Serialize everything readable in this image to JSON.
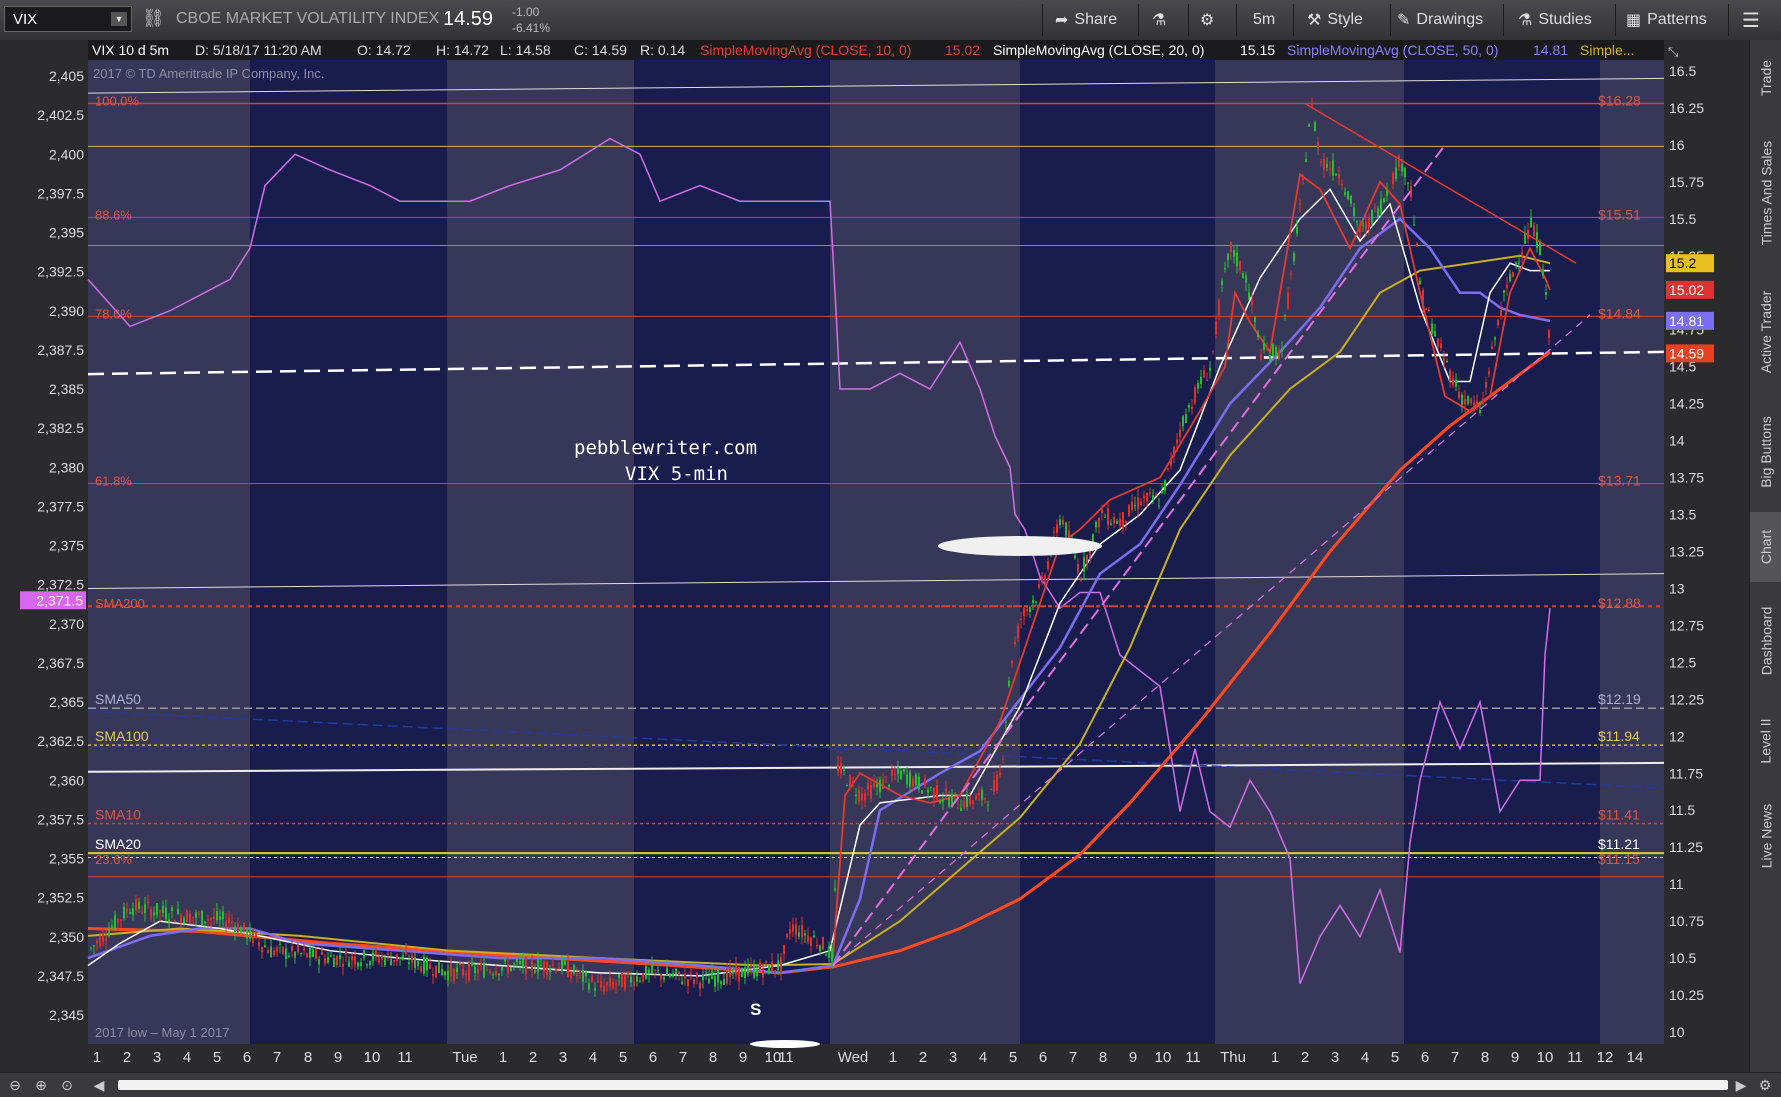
{
  "header": {
    "symbol": "VIX",
    "description": "CBOE MARKET VOLATILITY INDEX",
    "last": "14.59",
    "change": "-1.00",
    "change_pct": "-6.41%",
    "buttons": {
      "share": "Share",
      "period": "5m",
      "style": "Style",
      "drawings": "Drawings",
      "studies": "Studies",
      "patterns": "Patterns"
    }
  },
  "sidebar_tabs": [
    "Trade",
    "Times And Sales",
    "Active Trader",
    "Big Buttons",
    "Chart",
    "Dashboard",
    "Level II",
    "Live News"
  ],
  "chart": {
    "info": {
      "title": "VIX 10 d 5m",
      "date": "D: 5/18/17 11:20 AM",
      "open": "O: 14.72",
      "high": "H: 14.72",
      "low": "L: 14.58",
      "close": "C: 14.59",
      "range": "R: 0.14",
      "sma10": "SimpleMovingAvg (CLOSE, 10, 0)",
      "sma10_val": "15.02",
      "sma20": "SimpleMovingAvg (CLOSE, 20, 0)",
      "sma20_val": "15.15",
      "sma50": "SimpleMovingAvg (CLOSE, 50, 0)",
      "sma50_val": "14.81",
      "more": "Simple..."
    },
    "copyright": "2017 © TD Ameritrade IP Company, Inc.",
    "watermark_line1": "pebblewriter.com",
    "watermark_line2": "VIX 5-min",
    "bottom_note": "2017 low – May 1 2017",
    "s_label": "S",
    "left_axis": [
      "2,405",
      "2,402.5",
      "2,400",
      "2,397.5",
      "2,395",
      "2,392.5",
      "2,390",
      "2,387.5",
      "2,385",
      "2,382.5",
      "2,380",
      "2,377.5",
      "2,375",
      "2,372.5",
      "2,370",
      "2,367.5",
      "2,365",
      "2,362.5",
      "2,360",
      "2,357.5",
      "2,355",
      "2,352.5",
      "2,350",
      "2,347.5",
      "2,345"
    ],
    "right_axis": [
      "16.5",
      "16.25",
      "16",
      "15.75",
      "15.5",
      "15.25",
      "15",
      "14.75",
      "14.5",
      "14.25",
      "14",
      "13.75",
      "13.5",
      "13.25",
      "13",
      "12.75",
      "12.5",
      "12.25",
      "12",
      "11.75",
      "11.5",
      "11.25",
      "11",
      "10.75",
      "10.5",
      "10.25",
      "10"
    ],
    "left_price_tag": "2,371.5",
    "right_tags": {
      "sma20": "15.2",
      "sma10": "15.02",
      "sma50": "14.81",
      "last": "14.59"
    },
    "x_labels": [
      "1",
      "2",
      "3",
      "4",
      "5",
      "6",
      "7",
      "8",
      "9",
      "10",
      "11",
      "Tue",
      "1",
      "2",
      "3",
      "4",
      "5",
      "6",
      "7",
      "8",
      "9",
      "10",
      "11",
      "Wed",
      "1",
      "2",
      "3",
      "4",
      "5",
      "6",
      "7",
      "8",
      "9",
      "10",
      "11",
      "Thu",
      "1",
      "2",
      "3",
      "4",
      "5",
      "6",
      "7",
      "8",
      "9",
      "10",
      "11",
      "12",
      "14"
    ],
    "fib_levels": [
      {
        "label": "100.0%",
        "price": "$16.28"
      },
      {
        "label": "88.6%",
        "price": "$15.51"
      },
      {
        "label": "78.6%",
        "price": "$14.84"
      },
      {
        "label": "61.8%",
        "price": "$13.71"
      },
      {
        "label": "SMA200",
        "price": "$12.88"
      },
      {
        "label": "23.6%",
        "price": "$11.15"
      }
    ],
    "sma_levels": [
      {
        "label": "SMA50",
        "price": "$12.19"
      },
      {
        "label": "SMA100",
        "price": "$11.94"
      },
      {
        "label": "SMA10",
        "price": "$11.41"
      },
      {
        "label": "SMA20",
        "price": "$11.21"
      }
    ],
    "colors": {
      "bg": "#191d4d",
      "shade": "#37375a",
      "sma10": "#e53a2e",
      "sma20": "#ffffff",
      "sma50": "#7d6df0",
      "sma100": "#c8b020",
      "sma200": "#ff4a20",
      "spx": "#d26ee6",
      "fib": "#d94030"
    }
  }
}
